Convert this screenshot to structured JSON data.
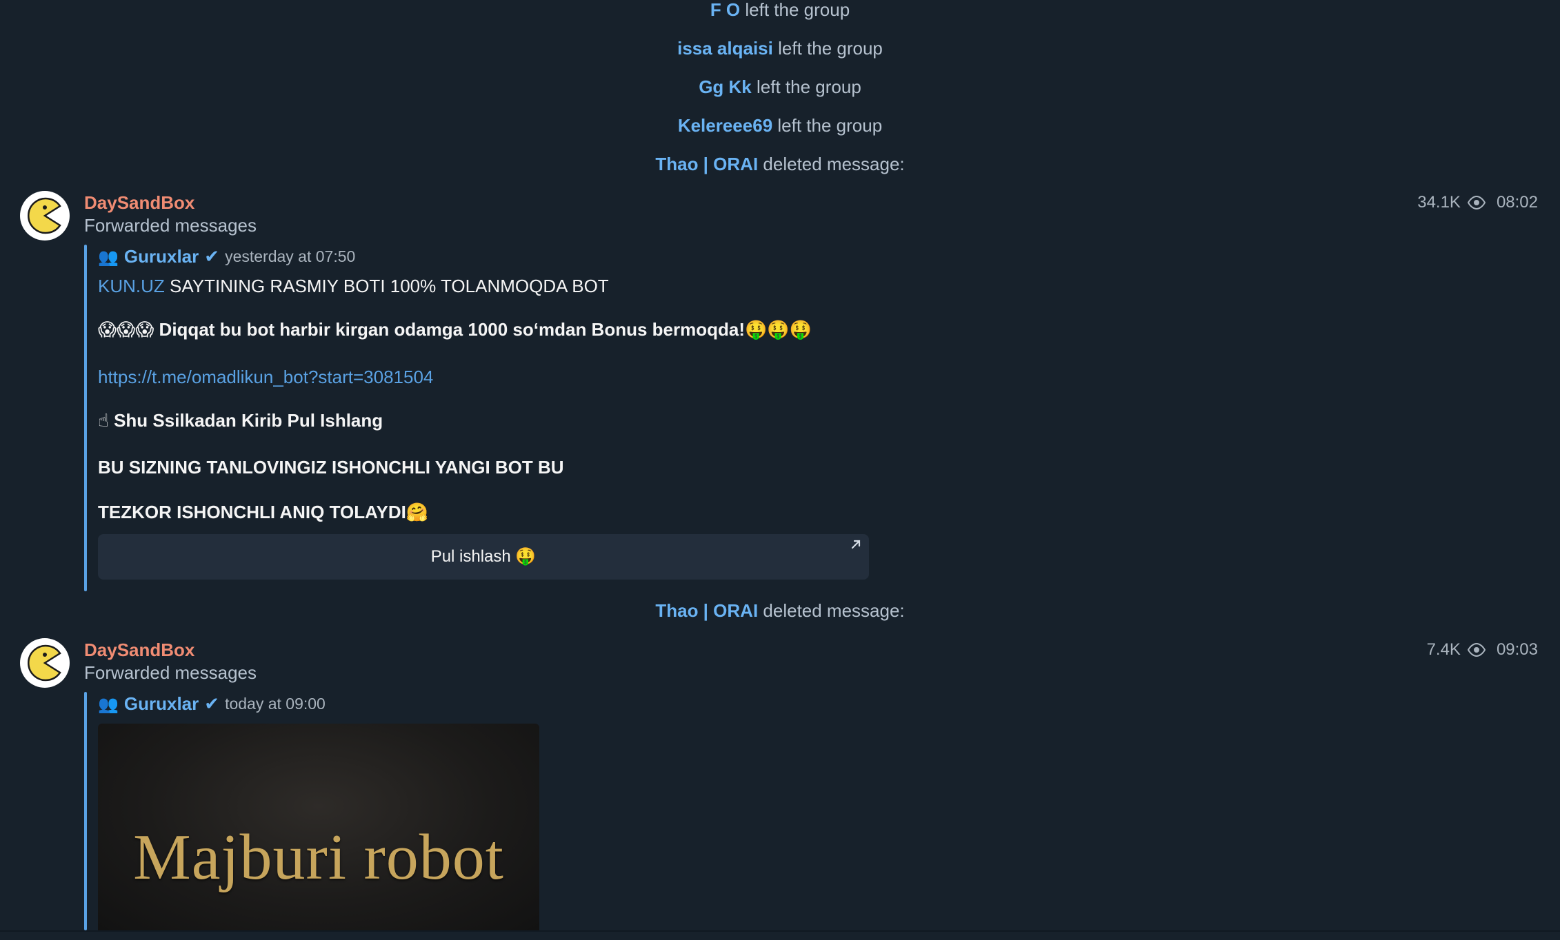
{
  "service_messages": [
    {
      "actor": "F O",
      "text": "left the group"
    },
    {
      "actor": "issa alqaisi",
      "text": "left the group"
    },
    {
      "actor": "Gg Kk",
      "text": "left the group"
    },
    {
      "actor": "Kelereee69",
      "text": "left the group"
    },
    {
      "actor": "Thao | ORAI",
      "text": "deleted message:"
    },
    {
      "actor": "Thao | ORAI",
      "text": "deleted message:"
    }
  ],
  "messages": [
    {
      "sender": "DaySandBox",
      "forward_label": "Forwarded messages",
      "views": "34.1K",
      "time": "08:02",
      "forwarded_from": {
        "icon": "👥",
        "channel": "Guruxlar",
        "verified_mark": "✔",
        "when": "yesterday at 07:50"
      },
      "body": {
        "line1_link": "KUN.UZ",
        "line1_rest": " SAYTINING RASMIY BOTI 100% TOLANMOQDA BOT",
        "line2_emoji_pre": "😱😱😱",
        "line2_text": " Diqqat bu bot harbir kirgan odamga 1000 so‘mdan Bonus bermoqda!",
        "line2_emoji_post": "🤑🤑🤑",
        "line3_url": "https://t.me/omadlikun_bot?start=3081504",
        "line4_emoji": "☝",
        "line4_text": "Shu Ssilkadan Kirib Pul Ishlang",
        "line5_text": "BU SIZNING TANLOVINGIZ ISHONCHLI YANGI BOT BU",
        "line6_text": "TEZKOR ISHONCHLI ANIQ TOLAYDI",
        "line6_emoji": "🤗"
      },
      "inline_button": {
        "label": "Pul ishlash 🤑",
        "arrow": "↗"
      }
    },
    {
      "sender": "DaySandBox",
      "forward_label": "Forwarded messages",
      "views": "7.4K",
      "time": "09:03",
      "forwarded_from": {
        "icon": "👥",
        "channel": "Guruxlar",
        "verified_mark": "✔",
        "when": "today at 09:00"
      },
      "media_title": "Majburi robot"
    }
  ],
  "colors": {
    "background": "#17212b",
    "sender_name": "#f08c73",
    "accent_blue": "#6ab3f3",
    "forward_bar": "#5aa2e4",
    "muted_text": "#b6c2cf",
    "button_bg": "#232e3c"
  }
}
